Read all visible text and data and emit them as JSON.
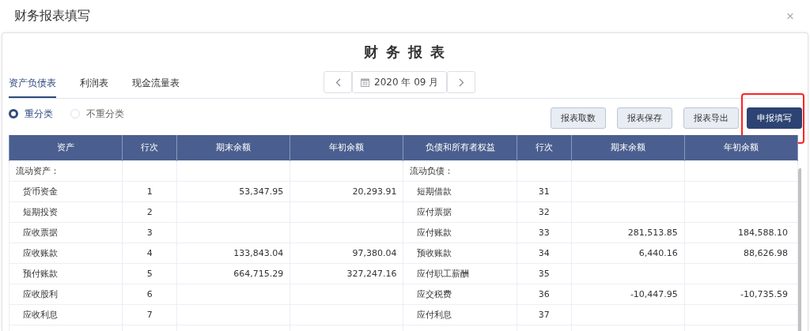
{
  "window": {
    "title": "财务报表填写",
    "close": "×"
  },
  "report": {
    "title": "财 务 报 表"
  },
  "tabs": [
    {
      "label": "资产负债表",
      "selected": true
    },
    {
      "label": "利润表",
      "selected": false
    },
    {
      "label": "现金流量表",
      "selected": false
    }
  ],
  "period": {
    "value": "2020 年 09 月"
  },
  "radios": [
    {
      "label": "重分类",
      "selected": true
    },
    {
      "label": "不重分类",
      "selected": false
    }
  ],
  "buttons": [
    {
      "label": "报表取数",
      "kind": "secondary",
      "highlighted": false
    },
    {
      "label": "报表保存",
      "kind": "secondary",
      "highlighted": false
    },
    {
      "label": "报表导出",
      "kind": "secondary",
      "highlighted": false
    },
    {
      "label": "申报填写",
      "kind": "primary",
      "highlighted": true
    }
  ],
  "table": {
    "columns": [
      "资产",
      "行次",
      "期末余额",
      "年初余额",
      "负债和所有者权益",
      "行次",
      "期末余额",
      "年初余额"
    ],
    "rows": [
      {
        "kind": "section",
        "cells": [
          "流动资产：",
          "",
          "",
          "",
          "流动负债：",
          "",
          "",
          ""
        ]
      },
      {
        "kind": "item",
        "cells": [
          "货币资金",
          "1",
          "53,347.95",
          "20,293.91",
          "短期借款",
          "31",
          "",
          ""
        ]
      },
      {
        "kind": "item",
        "cells": [
          "短期投资",
          "2",
          "",
          "",
          "应付票据",
          "32",
          "",
          ""
        ]
      },
      {
        "kind": "item",
        "cells": [
          "应收票据",
          "3",
          "",
          "",
          "应付账款",
          "33",
          "281,513.85",
          "184,588.10"
        ]
      },
      {
        "kind": "item",
        "cells": [
          "应收账款",
          "4",
          "133,843.04",
          "97,380.04",
          "预收账款",
          "34",
          "6,440.16",
          "88,626.98"
        ]
      },
      {
        "kind": "item",
        "cells": [
          "预付账款",
          "5",
          "664,715.29",
          "327,247.16",
          "应付职工薪酬",
          "35",
          "",
          ""
        ]
      },
      {
        "kind": "item",
        "cells": [
          "应收股利",
          "6",
          "",
          "",
          "应交税费",
          "36",
          "-10,447.95",
          "-10,735.59"
        ]
      },
      {
        "kind": "item",
        "cells": [
          "应收利息",
          "7",
          "",
          "",
          "应付利息",
          "37",
          "",
          ""
        ]
      }
    ]
  }
}
